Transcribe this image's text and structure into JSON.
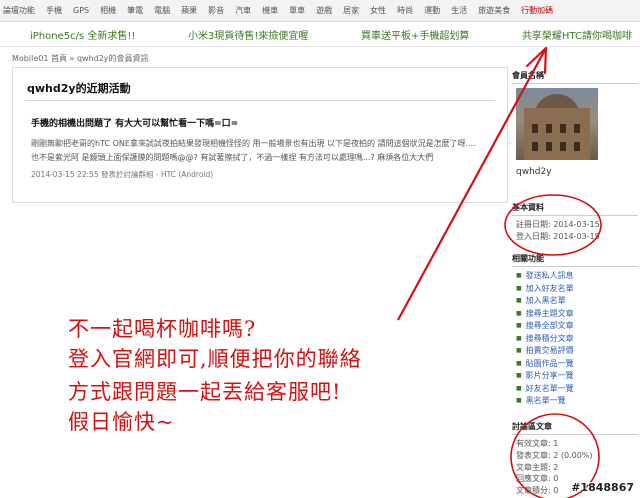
{
  "topnav": {
    "items": [
      "論壇功能",
      "手機",
      "GPS",
      "相機",
      "筆電",
      "電腦",
      "蘋果",
      "影音",
      "汽車",
      "機車",
      "單車",
      "遊戲",
      "居家",
      "女性",
      "時尚",
      "運動",
      "生活",
      "旅遊美食"
    ],
    "hot_item": "行動加碼"
  },
  "promo": {
    "links": [
      "iPhone5c/s 全新求售!!",
      "小米3現貨待售!來撿便宜喔",
      "買車送平板+手機超划算",
      "共享榮耀HTC請你喝咖啡"
    ]
  },
  "breadcrumb": "Mobile01 首頁 » qwhd2y的會員資訊",
  "main": {
    "title": "qwhd2y的近期活動",
    "post_title": "手機的相機出問題了 有大大可以幫忙看一下嗎=口=",
    "excerpt_1": "剛剛無聊把老哥的hTC ONE拿來試試夜拍結果發現相機怪怪的 用一般場景也有出現 以下是夜拍的 請問這個狀況是怎麼了呀....",
    "excerpt_2": "也不是紫光阿 是鏡頭上面保護膜的問題嗎@@? 有試著擦拭了，不過一樣捏 有方法可以處理嗎...? 麻煩各位大大們",
    "meta": "2014-03-15 22:55 發表於討論群組 - HTC (Android)"
  },
  "sidebar": {
    "member_heading": "會員名稱",
    "username": "qwhd2y",
    "basic_heading": "基本資料",
    "register_date": "註冊日期: 2014-03-15",
    "login_date": "登入日期: 2014-03-15",
    "functions_heading": "相關功能",
    "functions": [
      "發送私人訊息",
      "加入好友名單",
      "加入黑名單",
      "搜尋主題文章",
      "搜尋全部文章",
      "搜尋積分文章",
      "拍賣交易評價",
      "貼圖作品一覽",
      "影片分享一覽",
      "好友名單一覽",
      "黑名單一覽"
    ],
    "forum_heading": "討論區文章",
    "forum_stats": [
      "有效文章: 1",
      "發表文章: 2 (0.00%)",
      "文章主題: 2",
      "回應文章: 0",
      "文章積分: 0"
    ]
  },
  "annotation": {
    "line1": "不一起喝杯咖啡嗎?",
    "line2": "登入官網即可,順便把你的聯絡",
    "line3": "方式跟問題一起丟給客服吧!",
    "line4": "假日愉快~"
  },
  "watermark": "#1848867",
  "colors": {
    "promo_green": "#3a7a20",
    "annotation_red": "#d41010",
    "link_blue": "#2a5db0"
  }
}
